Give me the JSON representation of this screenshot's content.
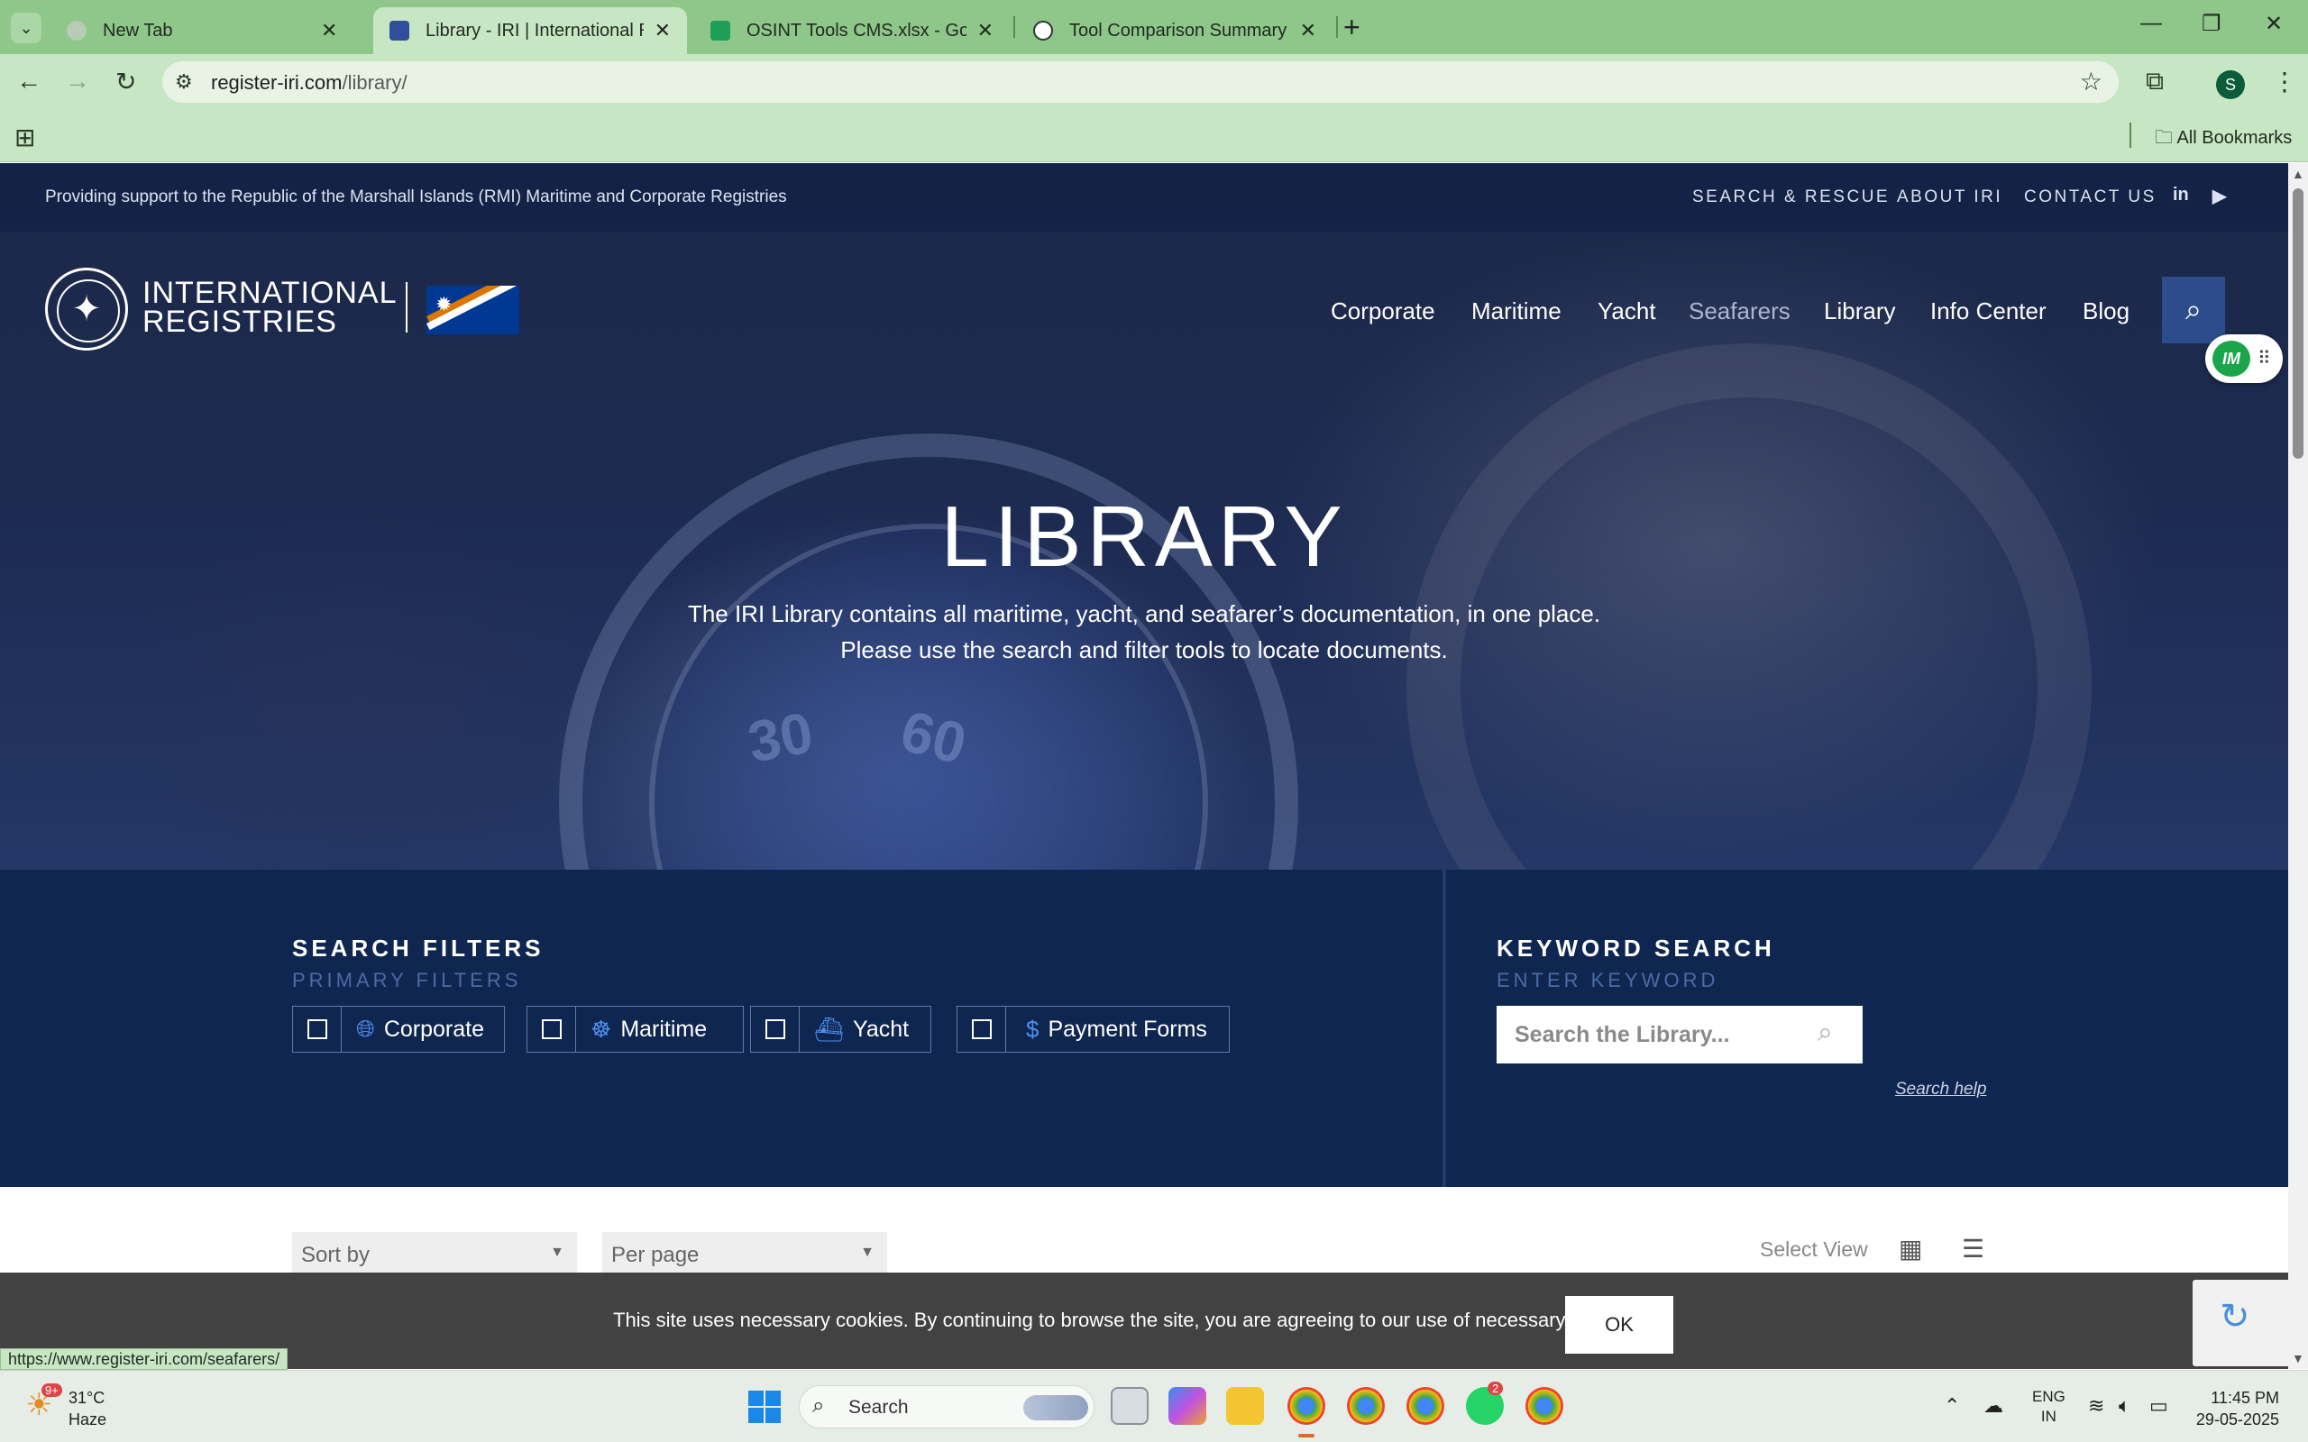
{
  "browser": {
    "tabs": [
      {
        "title": "New Tab",
        "active": false
      },
      {
        "title": "Library - IRI | International Registries",
        "active": true
      },
      {
        "title": "OSINT Tools CMS.xlsx - Google Sheets",
        "active": false
      },
      {
        "title": "Tool Comparison Summary",
        "active": false
      }
    ],
    "url_host": "register-iri.com",
    "url_path": "/library/",
    "profile_initial": "S",
    "all_bookmarks": "All Bookmarks",
    "status_url": "https://www.register-iri.com/seafarers/"
  },
  "site": {
    "tagline": "Providing support to the Republic of the Marshall Islands (RMI) Maritime and Corporate Registries",
    "top_links": [
      "SEARCH & RESCUE",
      "ABOUT IRI",
      "CONTACT US"
    ],
    "social": {
      "linkedin": "in",
      "youtube": "▶"
    },
    "logo": {
      "line1": "INTERNATIONAL",
      "line2": "REGISTRIES"
    },
    "nav": [
      "Corporate",
      "Maritime",
      "Yacht",
      "Seafarers",
      "Library",
      "Info Center",
      "Blog"
    ],
    "im_widget": "IM",
    "hero": {
      "title": "LIBRARY",
      "line1": "The IRI Library contains all maritime, yacht, and seafarer’s documentation, in one place.",
      "line2": "Please use the search and filter tools to locate documents.",
      "dial_numbers": [
        "30",
        "60"
      ]
    },
    "filters": {
      "heading": "SEARCH FILTERS",
      "subheading": "PRIMARY FILTERS",
      "chips": [
        {
          "label": "Corporate",
          "icon": "globe-icon",
          "checked": false
        },
        {
          "label": "Maritime",
          "icon": "ship-wheel-icon",
          "checked": false
        },
        {
          "label": "Yacht",
          "icon": "yacht-icon",
          "checked": false
        },
        {
          "label": "Payment Forms",
          "icon": "dollar-icon",
          "checked": false
        }
      ]
    },
    "keyword": {
      "heading": "KEYWORD SEARCH",
      "subheading": "ENTER KEYWORD",
      "placeholder": "Search the Library...",
      "help": "Search help"
    },
    "results": {
      "sort_by": "Sort by",
      "per_page": "Per page",
      "select_view": "Select View"
    },
    "cookie": {
      "text": "This site uses necessary cookies. By continuing to browse the site, you are agreeing to our use of necessary cookies.",
      "ok": "OK"
    }
  },
  "taskbar": {
    "weather_badge": "9+",
    "temp": "31°C",
    "condition": "Haze",
    "search": "Search",
    "whatsapp_badge": "2",
    "lang_line1": "ENG",
    "lang_line2": "IN",
    "time": "11:45 PM",
    "date": "29-05-2025"
  }
}
